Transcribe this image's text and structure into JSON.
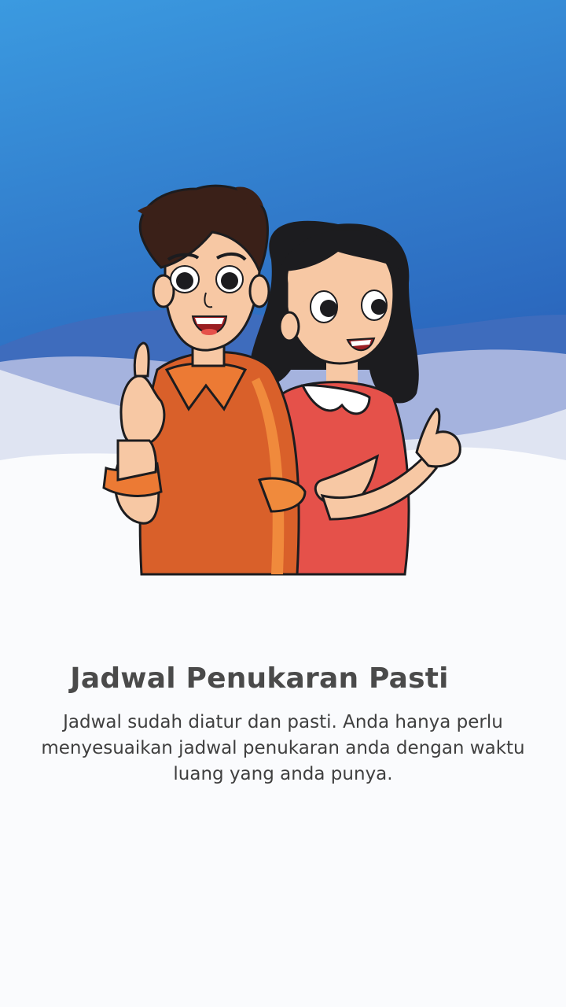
{
  "onboarding": {
    "title": "Jadwal Penukaran Pasti",
    "description": "Jadwal sudah diatur dan pasti. Anda hanya perlu menyesuaikan jadwal penukaran anda dengan waktu luang yang anda punya."
  },
  "colors": {
    "sky_top": "#3b9ae0",
    "sky_bottom": "#2a6fc4",
    "wave_dark": "#3f6fbf",
    "wave_mid": "#a6b4df",
    "wave_light": "#dfe4f2",
    "background": "#fafbfd",
    "boy_shirt": "#d9602a",
    "girl_dress": "#e5514a",
    "title_text": "#4a4a4a",
    "body_text": "#3f3f3f"
  },
  "illustration": {
    "icon": "two-kids-thumbs-up-illustration"
  }
}
